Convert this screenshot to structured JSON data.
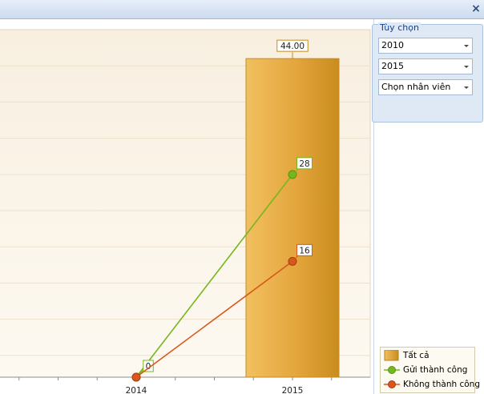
{
  "window": {
    "close_glyph": "×"
  },
  "options": {
    "group_label": "Tùy chọn",
    "from_year": "2010",
    "to_year": "2015",
    "employee": "Chọn nhân viên"
  },
  "colors": {
    "bar": "#e9ab43",
    "bar_dark": "#c68b1f",
    "sent_success": "#75b71d",
    "not_success": "#d9561c",
    "plot_bg": "#f9f1e0"
  },
  "chart_data": {
    "type": "bar",
    "categories": [
      "2014",
      "2015"
    ],
    "series": [
      {
        "name": "Tất cả",
        "type": "bar",
        "values": [
          0,
          44
        ],
        "labels": [
          "",
          "44.00"
        ]
      },
      {
        "name": "Gửi thành công",
        "type": "line",
        "values": [
          0,
          28
        ],
        "labels": [
          "0",
          "28"
        ]
      },
      {
        "name": "Không thành công",
        "type": "line",
        "values": [
          0,
          16
        ],
        "labels": [
          "",
          "16"
        ]
      }
    ],
    "legend_position": "bottom-right",
    "grid": true
  }
}
